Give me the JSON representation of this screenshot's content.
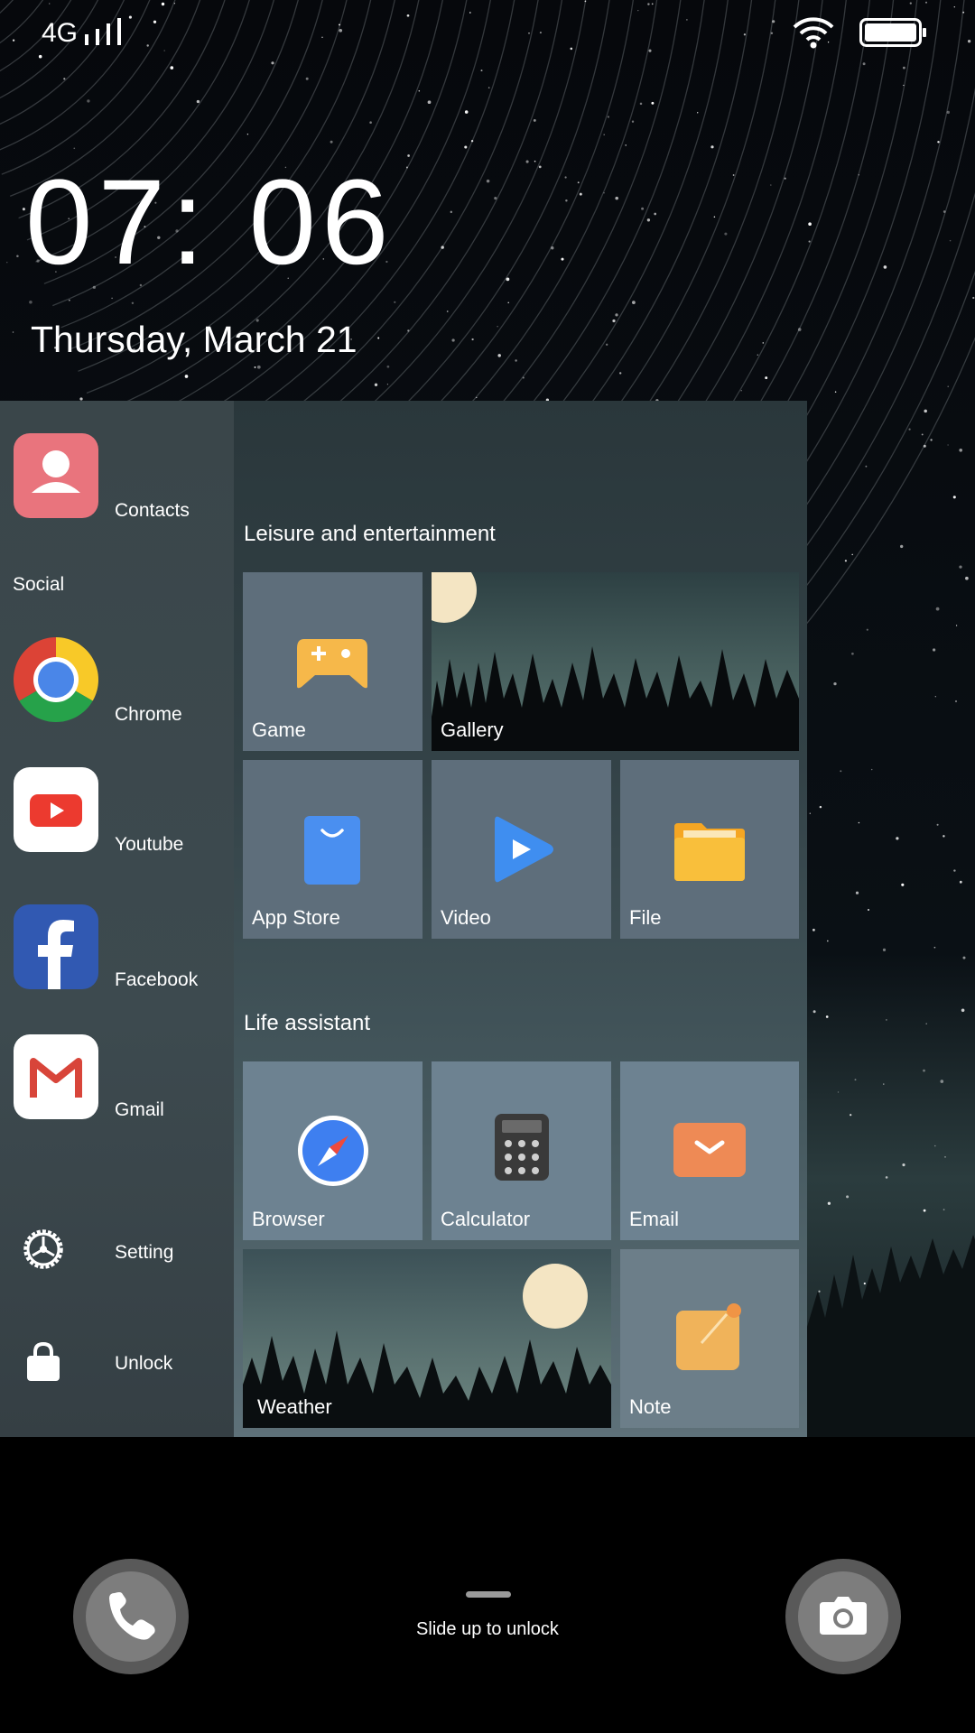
{
  "status": {
    "network": "4G",
    "icons": [
      "signal-icon",
      "wifi-icon",
      "battery-icon"
    ]
  },
  "lock": {
    "time": "07: 06",
    "date": "Thursday, March 21"
  },
  "sidebar": {
    "contacts": "Contacts",
    "social_header": "Social",
    "chrome": "Chrome",
    "youtube": "Youtube",
    "facebook": "Facebook",
    "gmail": "Gmail",
    "setting": "Setting",
    "unlock": "Unlock"
  },
  "sections": {
    "leisure": {
      "title": "Leisure and entertainment",
      "game": "Game",
      "gallery": "Gallery",
      "appstore": "App Store",
      "video": "Video",
      "file": "File"
    },
    "life": {
      "title": "Life assistant",
      "browser": "Browser",
      "calculator": "Calculator",
      "email": "Email",
      "weather": "Weather",
      "note": "Note"
    }
  },
  "bottom": {
    "slide_text": "Slide up to unlock",
    "icons": [
      "phone-icon",
      "camera-icon"
    ]
  },
  "colors": {
    "game": "#f6b84a",
    "appstore": "#4a8ff0",
    "video": "#3f8ef0",
    "file": "#f7b630",
    "email": "#ee8a55",
    "note": "#f0b35a",
    "moon": "#f4e5c3",
    "contacts": "#e9747d"
  }
}
